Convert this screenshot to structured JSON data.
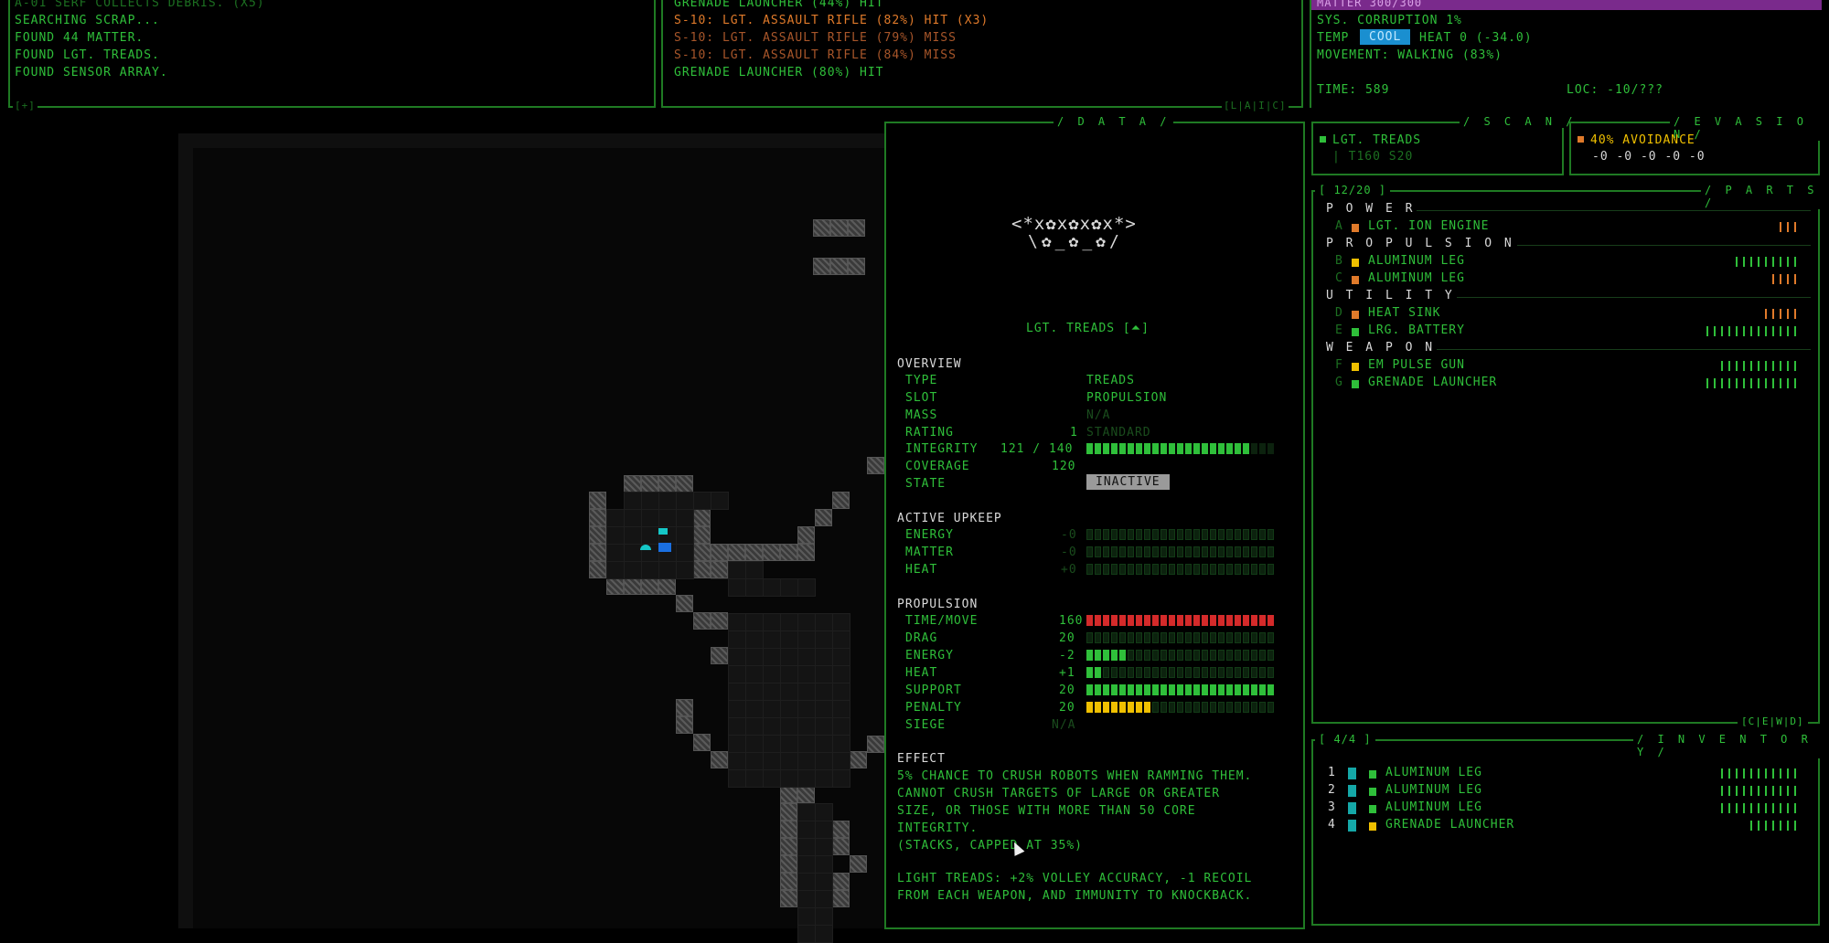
{
  "log": {
    "lines": [
      "A-01 Serf collects debris. (x5)",
      "Searching scrap...",
      "Found 44 matter.",
      "Found Lgt. Treads.",
      "Found Sensor Array."
    ],
    "corner_label": "[+]"
  },
  "combat": {
    "lines": [
      {
        "text": "Grenade Launcher (44%) Hit",
        "color": "#2fbf3a"
      },
      {
        "text": "S-10: Lgt. Assault Rifle (82%) Hit (x3)",
        "color": "#e07a2a"
      },
      {
        "text": "S-10: Lgt. Assault Rifle (79%) Miss",
        "color": "#a8562a"
      },
      {
        "text": "S-10: Lgt. Assault Rifle (84%) Miss",
        "color": "#a8562a"
      },
      {
        "text": "Grenade Launcher (80%) Hit",
        "color": "#2fbf3a"
      }
    ],
    "corner_label": "[L|A|I|C]"
  },
  "status": {
    "matter": "Matter 300/300",
    "corruption": "Sys. Corruption 1%",
    "temp_label": "Temp",
    "temp_badge": "Cool",
    "heat": "Heat 0 (-34.0)",
    "movement": "Movement: Walking (83%)",
    "time": "Time: 589",
    "loc": "Loc: -10/???"
  },
  "scan": {
    "title": "/ S C A N /",
    "item": "Lgt. Treads",
    "sub": "| T160 S20"
  },
  "evasion": {
    "title": "/ E V A S I O N /",
    "value": "40% Avoidance",
    "sub": "-0 -0 -0 -0 -0"
  },
  "parts": {
    "header": "[ 12/20 ]",
    "title": "/ P A R T S /",
    "footer": "[C|E|W|D]",
    "groups": [
      {
        "name": "P O W E R",
        "items": [
          {
            "key": "A",
            "label": "Lgt. Ion Engine",
            "color": "#e07a2a",
            "ticks": 3,
            "tick_color": "#e07a2a"
          }
        ]
      },
      {
        "name": "P R O P U L S I O N",
        "items": [
          {
            "key": "B",
            "label": "Aluminum Leg",
            "color": "#f0c000",
            "ticks": 9,
            "tick_color": "#2fbf3a"
          },
          {
            "key": "C",
            "label": "Aluminum Leg",
            "color": "#e07a2a",
            "ticks": 4,
            "tick_color": "#e07a2a"
          }
        ]
      },
      {
        "name": "U T I L I T Y",
        "items": [
          {
            "key": "D",
            "label": "Heat Sink",
            "color": "#e07a2a",
            "ticks": 5,
            "tick_color": "#e07a2a"
          },
          {
            "key": "E",
            "label": "Lrg. Battery",
            "color": "#2fbf3a",
            "ticks": 13,
            "tick_color": "#2fbf3a"
          }
        ]
      },
      {
        "name": "W E A P O N",
        "items": [
          {
            "key": "F",
            "label": "EM Pulse Gun",
            "color": "#f0c000",
            "ticks": 11,
            "tick_color": "#2fbf3a"
          },
          {
            "key": "G",
            "label": "Grenade Launcher",
            "color": "#2fbf3a",
            "ticks": 13,
            "tick_color": "#2fbf3a"
          }
        ]
      }
    ]
  },
  "inventory": {
    "header": "[ 4/4 ]",
    "title": "/ I N V E N T O R Y /",
    "items": [
      {
        "key": "1",
        "label": "Aluminum Leg",
        "color": "#2fbf3a",
        "ticks": 11
      },
      {
        "key": "2",
        "label": "Aluminum Leg",
        "color": "#2fbf3a",
        "ticks": 11
      },
      {
        "key": "3",
        "label": "Aluminum Leg",
        "color": "#2fbf3a",
        "ticks": 11
      },
      {
        "key": "4",
        "label": "Grenade Launcher",
        "color": "#f0c000",
        "ticks": 7
      }
    ]
  },
  "data": {
    "title": "/ D A T A /",
    "art_line1": "<*x✿x✿x✿x*>",
    "art_line2": "\\✿_✿_✿/",
    "item_name": "Lgt. Treads [⏶]",
    "overview_title": "Overview",
    "overview": [
      {
        "label": "Type",
        "value": "Treads"
      },
      {
        "label": "Slot",
        "value": "Propulsion"
      },
      {
        "label": "Mass",
        "value": "N/A"
      },
      {
        "label": "Rating",
        "num": "1",
        "value": "Standard"
      }
    ],
    "integrity": {
      "label": "Integrity",
      "num": "121 / 140",
      "fill": 0.864
    },
    "coverage": {
      "label": "Coverage",
      "num": "120"
    },
    "state": {
      "label": "State",
      "value": "Inactive"
    },
    "upkeep_title": "Active Upkeep",
    "upkeep": [
      {
        "label": "Energy",
        "num": "-0",
        "fill": 0
      },
      {
        "label": "Matter",
        "num": "-0",
        "fill": 0
      },
      {
        "label": "Heat",
        "num": "+0",
        "fill": 0
      }
    ],
    "propulsion_title": "Propulsion",
    "propulsion": [
      {
        "label": "Time/Move",
        "num": "160",
        "fill": 1.0,
        "color": "#d42a2a"
      },
      {
        "label": "Drag",
        "num": "20",
        "fill": 0,
        "color": "#2fbf3a"
      },
      {
        "label": "Energy",
        "num": "-2",
        "fill": 0.2,
        "color": "#2fbf3a"
      },
      {
        "label": "Heat",
        "num": "+1",
        "fill": 0.1,
        "color": "#2fbf3a"
      },
      {
        "label": "Support",
        "num": "20",
        "fill": 1.0,
        "color": "#2fbf3a"
      },
      {
        "label": " Penalty",
        "num": "20",
        "fill": 0.33,
        "color": "#f0c000"
      },
      {
        "label": "Siege",
        "num": "N/A",
        "fill": null,
        "color": "#2fbf3a"
      }
    ],
    "effect_title": "Effect",
    "effect_lines": [
      "5% chance to crush robots when ramming them.",
      "Cannot crush targets of Large or greater",
      "size, or those with more than 50 core",
      "integrity.",
      " (Stacks, capped at 35%)"
    ],
    "effect_lines2": [
      "Light Treads: +2% volley accuracy, -1 recoil",
      "from each weapon, and immunity to knockback."
    ]
  }
}
